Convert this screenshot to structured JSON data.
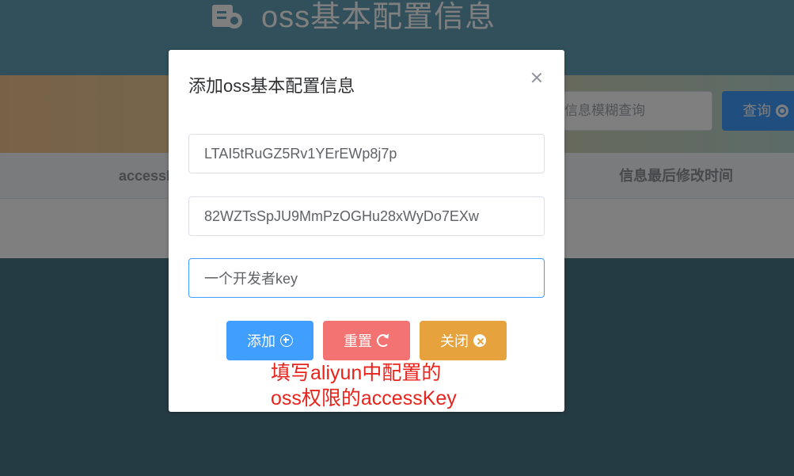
{
  "background": {
    "title": "oss基本配置信息",
    "search_placeholder": "信息模糊查询",
    "search_button": "查询",
    "table_headers": [
      "accessKey",
      "信息最后修改时间"
    ]
  },
  "dialog": {
    "title": "添加oss基本配置信息",
    "fields": [
      {
        "value": "LTAI5tRuGZ5Rv1YErEWp8j7p"
      },
      {
        "value": "82WZTsSpJU9MmPzOGHu28xWyDo7EXw"
      },
      {
        "value": "一个开发者key"
      }
    ],
    "buttons": {
      "add": "添加",
      "reset": "重置",
      "close": "关闭"
    },
    "annotation": [
      "填写aliyun中配置的",
      "oss权限的accessKey"
    ]
  },
  "colors": {
    "primary": "#409eff",
    "danger": "#f37373",
    "warning": "#e6a23c",
    "annotation": "#e8231c"
  }
}
